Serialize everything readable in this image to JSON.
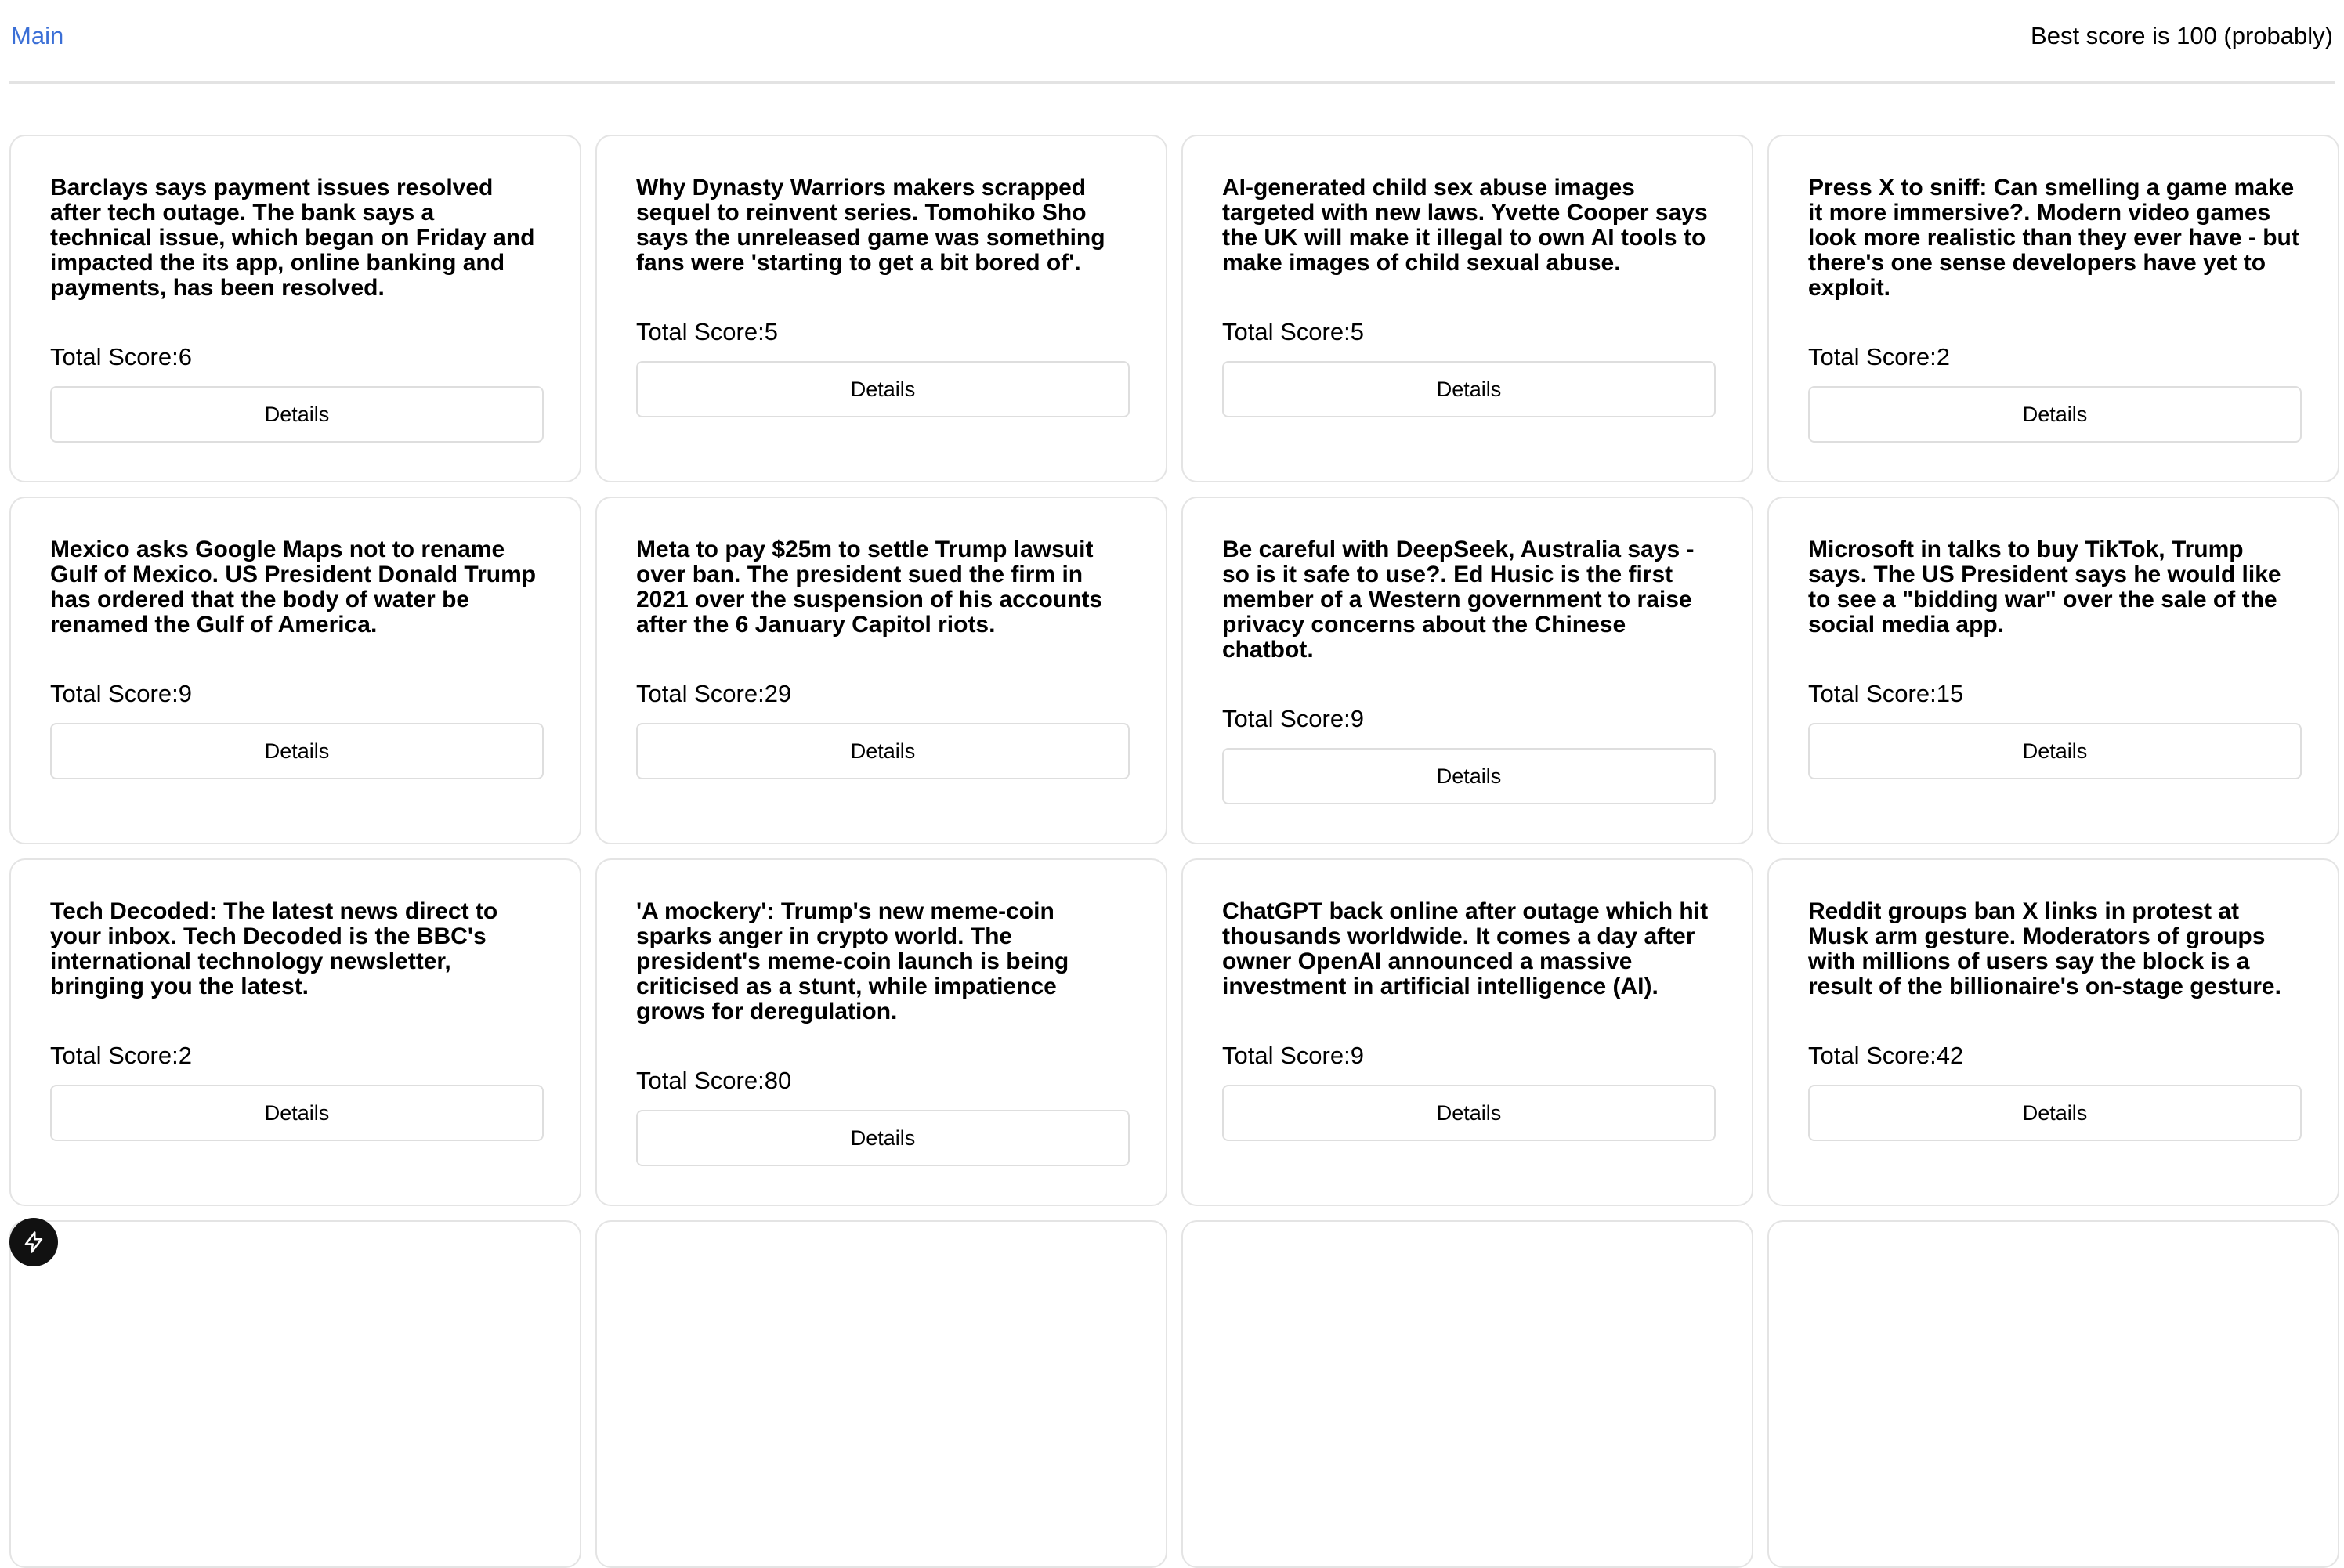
{
  "header": {
    "main_link": "Main",
    "best_score": "Best score is 100 (probably)"
  },
  "score_prefix": "Total Score:",
  "details_label": "Details",
  "cards": [
    {
      "title": "Barclays says payment issues resolved after tech outage. The bank says a technical issue, which began on Friday and impacted the its app, online banking and payments, has been resolved.",
      "score": "6"
    },
    {
      "title": "Why Dynasty Warriors makers scrapped sequel to reinvent series. Tomohiko Sho says the unreleased game was something fans were 'starting to get a bit bored of'.",
      "score": "5"
    },
    {
      "title": "AI-generated child sex abuse images targeted with new laws. Yvette Cooper says the UK will make it illegal to own AI tools to make images of child sexual abuse.",
      "score": "5"
    },
    {
      "title": "Press X to sniff: Can smelling a game make it more immersive?. Modern video games look more realistic than they ever have - but there's one sense developers have yet to exploit.",
      "score": "2"
    },
    {
      "title": "Mexico asks Google Maps not to rename Gulf of Mexico. US President Donald Trump has ordered that the body of water be renamed the Gulf of America.",
      "score": "9"
    },
    {
      "title": "Meta to pay $25m to settle Trump lawsuit over ban. The president sued the firm in 2021 over the suspension of his accounts after the 6 January Capitol riots.",
      "score": "29"
    },
    {
      "title": "Be careful with DeepSeek, Australia says - so is it safe to use?. Ed Husic is the first member of a Western government to raise privacy concerns about the Chinese chatbot.",
      "score": "9"
    },
    {
      "title": "Microsoft in talks to buy TikTok, Trump says. The US President says he would like to see a \"bidding war\" over the sale of the social media app.",
      "score": "15"
    },
    {
      "title": "Tech Decoded: The latest news direct to your inbox. Tech Decoded is the BBC's international technology newsletter, bringing you the latest.",
      "score": "2"
    },
    {
      "title": "'A mockery': Trump's new meme-coin sparks anger in crypto world. The president's meme-coin launch is being criticised as a stunt, while impatience grows for deregulation.",
      "score": "80"
    },
    {
      "title": "ChatGPT back online after outage which hit thousands worldwide. It comes a day after owner OpenAI announced a massive investment in artificial intelligence (AI).",
      "score": "9"
    },
    {
      "title": "Reddit groups ban X links in protest at Musk arm gesture. Moderators of groups with millions of users say the block is a result of the billionaire's on-stage gesture.",
      "score": "42"
    },
    {
      "title": "",
      "score": ""
    },
    {
      "title": "",
      "score": ""
    },
    {
      "title": "",
      "score": ""
    },
    {
      "title": "",
      "score": ""
    }
  ],
  "fab": {
    "icon": "lightning-icon"
  }
}
